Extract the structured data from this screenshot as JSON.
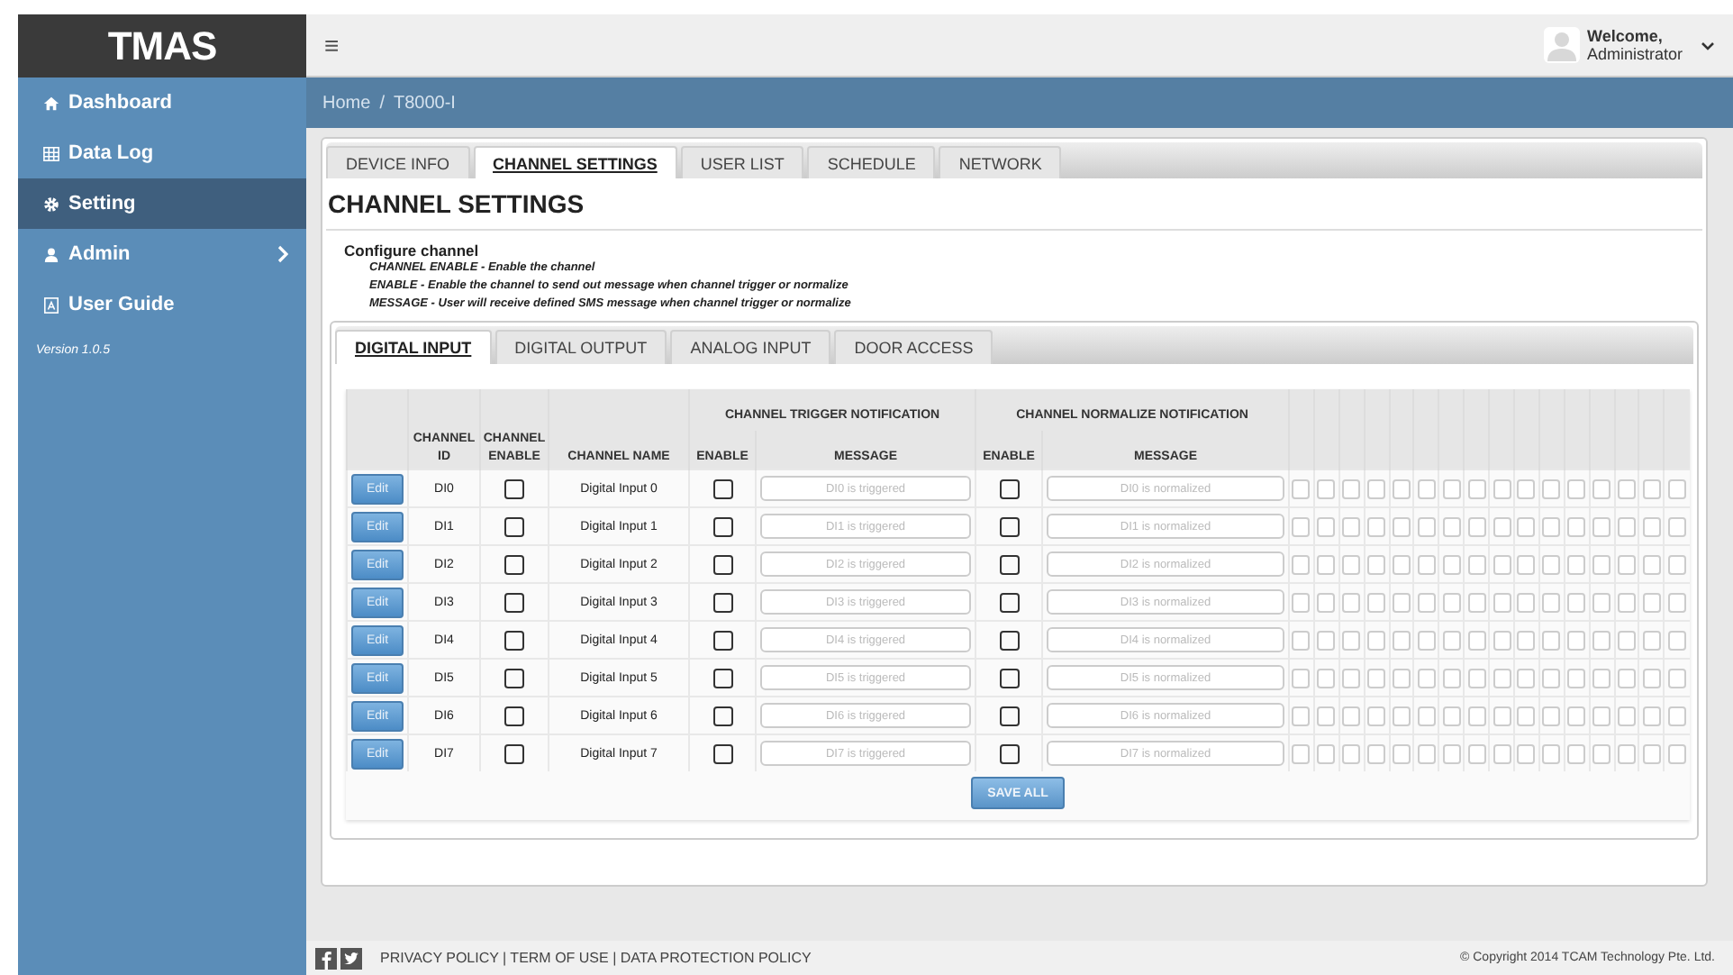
{
  "sidebar": {
    "logo": "TMAS",
    "items": [
      {
        "label": "Dashboard",
        "selected": false,
        "has_submenu": false
      },
      {
        "label": "Data Log",
        "selected": false,
        "has_submenu": false
      },
      {
        "label": "Setting",
        "selected": true,
        "has_submenu": false
      },
      {
        "label": "Admin",
        "selected": false,
        "has_submenu": true
      },
      {
        "label": "User Guide",
        "selected": false,
        "has_submenu": false
      }
    ],
    "version": "Version 1.0.5"
  },
  "topbar": {
    "menu_icon": "≡",
    "user": {
      "greeting": "Welcome,",
      "name": "Administrator"
    }
  },
  "breadcrumb": [
    "Home",
    "/",
    "T8000-I"
  ],
  "tabs": [
    {
      "label": "DEVICE INFO",
      "selected": false
    },
    {
      "label": "CHANNEL SETTINGS",
      "selected": true
    },
    {
      "label": "USER LIST",
      "selected": false
    },
    {
      "label": "SCHEDULE",
      "selected": false
    },
    {
      "label": "NETWORK",
      "selected": false
    }
  ],
  "page_title": "CHANNEL SETTINGS",
  "help": {
    "title": "Configure channel",
    "lines": [
      "CHANNEL ENABLE - Enable the channel",
      "ENABLE - Enable the channel to send out message when channel trigger or normalize",
      "MESSAGE - User will receive defined SMS message when channel trigger or normalize"
    ]
  },
  "subtabs": [
    {
      "label": "DIGITAL INPUT",
      "selected": true
    },
    {
      "label": "DIGITAL OUTPUT",
      "selected": false
    },
    {
      "label": "ANALOG INPUT",
      "selected": false
    },
    {
      "label": "DOOR ACCESS",
      "selected": false
    }
  ],
  "table": {
    "group_headers": [
      "CHANNEL TRIGGER NOTIFICATION",
      "CHANNEL NORMALIZE NOTIFICATION"
    ],
    "columns": [
      "CHANNEL ID",
      "CHANNEL ENABLE",
      "CHANNEL NAME",
      "ENABLE",
      "MESSAGE",
      "ENABLE",
      "MESSAGE"
    ],
    "rows": [
      {
        "button": "Edit",
        "id": "DI0",
        "enabled": false,
        "name": "Digital Input 0",
        "trigger_enabled": false,
        "trigger_placeholder": "DI0 is triggered",
        "normalize_enabled": false,
        "normalize_placeholder": "DI0 is normalized",
        "extra": [
          {
            "checked": false
          },
          {
            "checked": false
          },
          {
            "checked": false
          },
          {
            "checked": false
          },
          {
            "checked": false
          },
          {
            "checked": false
          },
          {
            "checked": false
          },
          {
            "checked": false
          },
          {
            "checked": false
          },
          {
            "checked": false
          },
          {
            "checked": false
          },
          {
            "checked": false
          },
          {
            "checked": false
          },
          {
            "checked": false
          },
          {
            "checked": false
          },
          {
            "checked": false
          }
        ]
      },
      {
        "button": "Edit",
        "id": "DI1",
        "enabled": false,
        "name": "Digital Input 1",
        "trigger_enabled": false,
        "trigger_placeholder": "DI1 is triggered",
        "normalize_enabled": false,
        "normalize_placeholder": "DI1 is normalized",
        "extra": [
          {
            "checked": false
          },
          {
            "checked": false
          },
          {
            "checked": false
          },
          {
            "checked": false
          },
          {
            "checked": false
          },
          {
            "checked": false
          },
          {
            "checked": false
          },
          {
            "checked": false
          },
          {
            "checked": false
          },
          {
            "checked": false
          },
          {
            "checked": false
          },
          {
            "checked": false
          },
          {
            "checked": false
          },
          {
            "checked": false
          },
          {
            "checked": false
          },
          {
            "checked": false
          }
        ]
      },
      {
        "button": "Edit",
        "id": "DI2",
        "enabled": false,
        "name": "Digital Input 2",
        "trigger_enabled": false,
        "trigger_placeholder": "DI2 is triggered",
        "normalize_enabled": false,
        "normalize_placeholder": "DI2 is normalized",
        "extra": [
          {
            "checked": false
          },
          {
            "checked": false
          },
          {
            "checked": false
          },
          {
            "checked": false
          },
          {
            "checked": false
          },
          {
            "checked": false
          },
          {
            "checked": false
          },
          {
            "checked": false
          },
          {
            "checked": false
          },
          {
            "checked": false
          },
          {
            "checked": false
          },
          {
            "checked": false
          },
          {
            "checked": false
          },
          {
            "checked": false
          },
          {
            "checked": false
          },
          {
            "checked": false
          }
        ]
      },
      {
        "button": "Edit",
        "id": "DI3",
        "enabled": false,
        "name": "Digital Input 3",
        "trigger_enabled": false,
        "trigger_placeholder": "DI3 is triggered",
        "normalize_enabled": false,
        "normalize_placeholder": "DI3 is normalized",
        "extra": [
          {
            "checked": false
          },
          {
            "checked": false
          },
          {
            "checked": false
          },
          {
            "checked": false
          },
          {
            "checked": false
          },
          {
            "checked": false
          },
          {
            "checked": false
          },
          {
            "checked": false
          },
          {
            "checked": false
          },
          {
            "checked": false
          },
          {
            "checked": false
          },
          {
            "checked": false
          },
          {
            "checked": false
          },
          {
            "checked": false
          },
          {
            "checked": false
          },
          {
            "checked": false
          }
        ]
      },
      {
        "button": "Edit",
        "id": "DI4",
        "enabled": false,
        "name": "Digital Input 4",
        "trigger_enabled": false,
        "trigger_placeholder": "DI4 is triggered",
        "normalize_enabled": false,
        "normalize_placeholder": "DI4 is normalized",
        "extra": [
          {
            "checked": false
          },
          {
            "checked": false
          },
          {
            "checked": false
          },
          {
            "checked": false
          },
          {
            "checked": false
          },
          {
            "checked": false
          },
          {
            "checked": false
          },
          {
            "checked": false
          },
          {
            "checked": false
          },
          {
            "checked": false
          },
          {
            "checked": false
          },
          {
            "checked": false
          },
          {
            "checked": false
          },
          {
            "checked": false
          },
          {
            "checked": false
          },
          {
            "checked": false
          }
        ]
      },
      {
        "button": "Edit",
        "id": "DI5",
        "enabled": false,
        "name": "Digital Input 5",
        "trigger_enabled": false,
        "trigger_placeholder": "DI5 is triggered",
        "normalize_enabled": false,
        "normalize_placeholder": "DI5 is normalized",
        "extra": [
          {
            "checked": false
          },
          {
            "checked": false
          },
          {
            "checked": false
          },
          {
            "checked": false
          },
          {
            "checked": false
          },
          {
            "checked": false
          },
          {
            "checked": false
          },
          {
            "checked": false
          },
          {
            "checked": false
          },
          {
            "checked": false
          },
          {
            "checked": false
          },
          {
            "checked": false
          },
          {
            "checked": false
          },
          {
            "checked": false
          },
          {
            "checked": false
          },
          {
            "checked": false
          }
        ]
      },
      {
        "button": "Edit",
        "id": "DI6",
        "enabled": false,
        "name": "Digital Input 6",
        "trigger_enabled": false,
        "trigger_placeholder": "DI6 is triggered",
        "normalize_enabled": false,
        "normalize_placeholder": "DI6 is normalized",
        "extra": [
          {
            "checked": false
          },
          {
            "checked": false
          },
          {
            "checked": false
          },
          {
            "checked": false
          },
          {
            "checked": false
          },
          {
            "checked": false
          },
          {
            "checked": false
          },
          {
            "checked": false
          },
          {
            "checked": false
          },
          {
            "checked": false
          },
          {
            "checked": false
          },
          {
            "checked": false
          },
          {
            "checked": false
          },
          {
            "checked": false
          },
          {
            "checked": false
          },
          {
            "checked": false
          }
        ]
      },
      {
        "button": "Edit",
        "id": "DI7",
        "enabled": false,
        "name": "Digital Input 7",
        "trigger_enabled": false,
        "trigger_placeholder": "DI7 is triggered",
        "normalize_enabled": false,
        "normalize_placeholder": "DI7 is normalized",
        "extra": [
          {
            "checked": false
          },
          {
            "checked": false
          },
          {
            "checked": false
          },
          {
            "checked": false
          },
          {
            "checked": false
          },
          {
            "checked": false
          },
          {
            "checked": false
          },
          {
            "checked": false
          },
          {
            "checked": false
          },
          {
            "checked": false
          },
          {
            "checked": false
          },
          {
            "checked": false
          },
          {
            "checked": false
          },
          {
            "checked": false
          },
          {
            "checked": false
          },
          {
            "checked": false
          }
        ]
      }
    ],
    "save_button": "SAVE ALL"
  },
  "footer": {
    "links": "PRIVACY POLICY | TERM OF USE | DATA PROTECTION POLICY",
    "copyright": "© Copyright 2014 TCAM Technology Pte. Ltd."
  }
}
